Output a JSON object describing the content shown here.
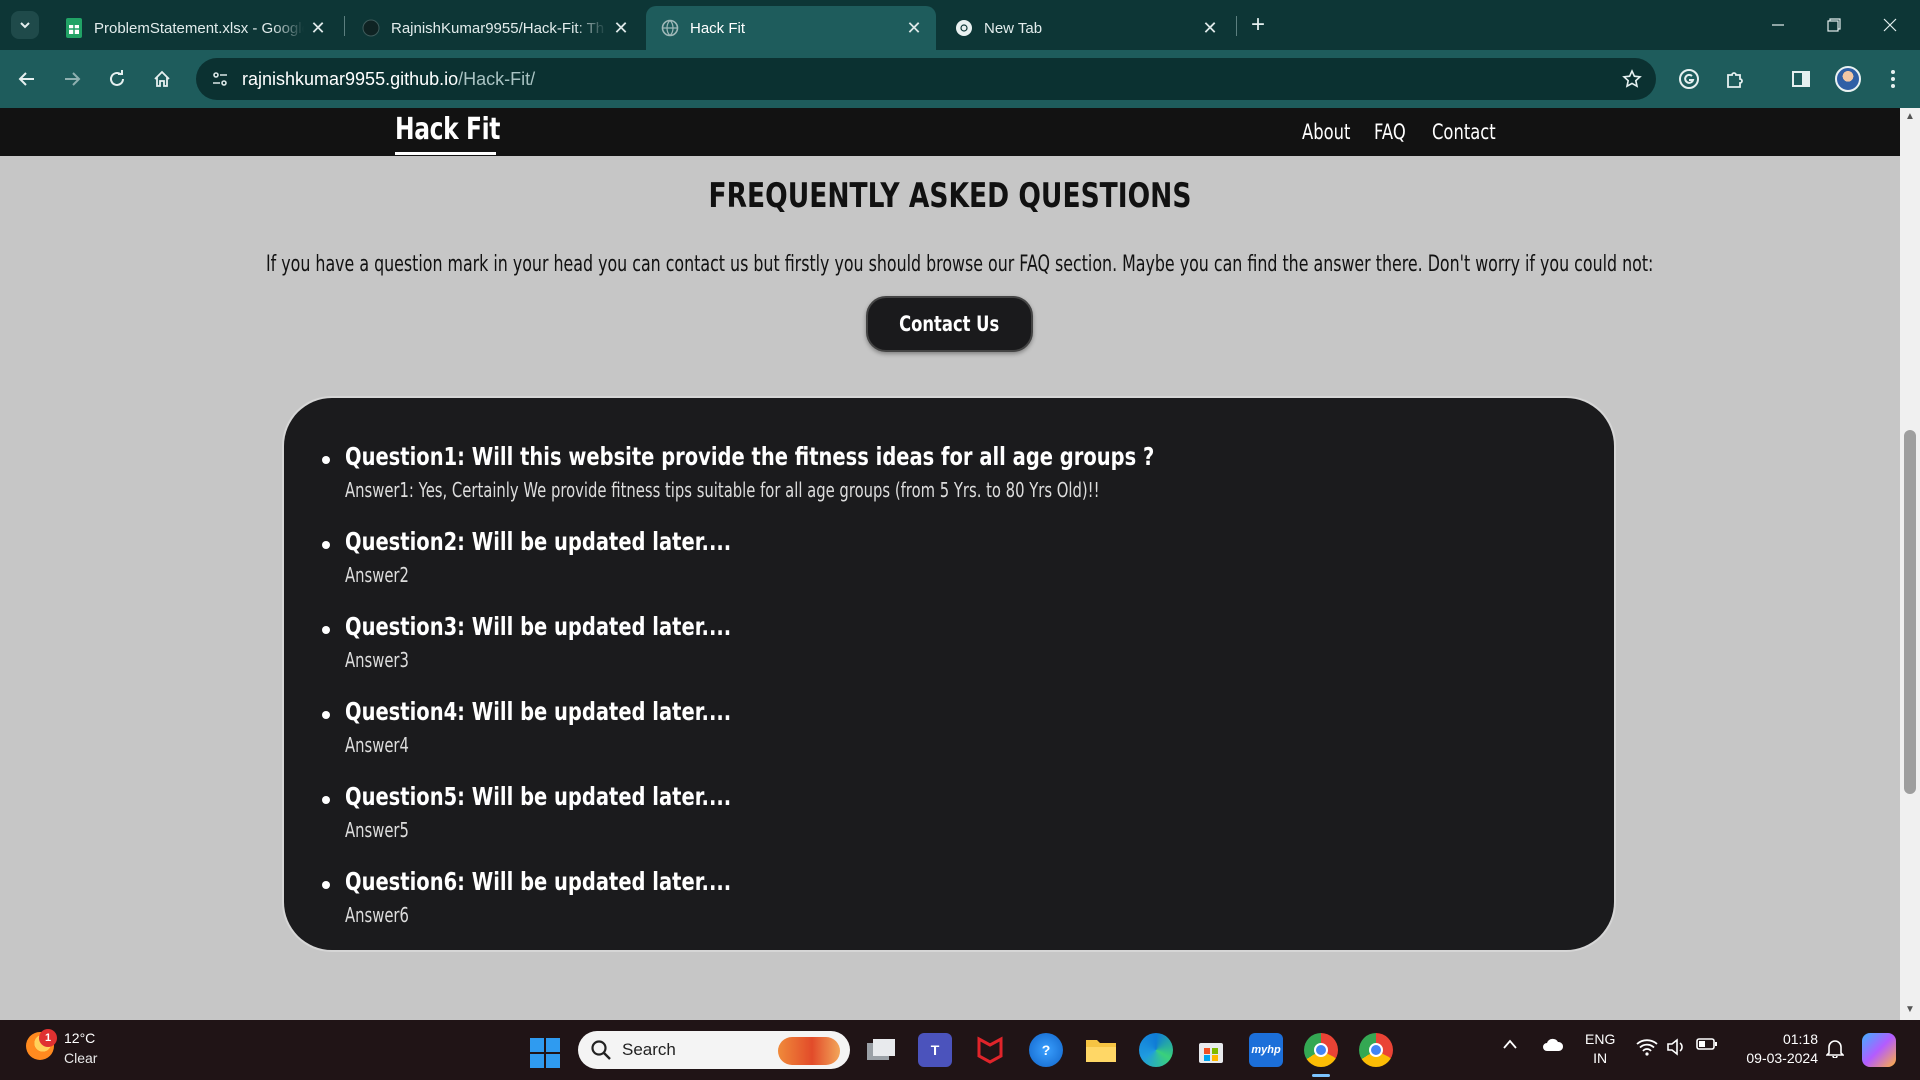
{
  "browser": {
    "tabs": [
      {
        "title": "ProblemStatement.xlsx - Google",
        "icon": "sheets-icon"
      },
      {
        "title": "RajnishKumar9955/Hack-Fit: Th",
        "icon": "github-icon"
      },
      {
        "title": "Hack Fit",
        "icon": "globe-icon"
      },
      {
        "title": "New Tab",
        "icon": "chrome-icon"
      }
    ],
    "active_tab": 2,
    "url_host": "rajnishkumar9955.github.io",
    "url_path": "/Hack-Fit/"
  },
  "site": {
    "brand": "Hack Fit",
    "nav": [
      "About",
      "FAQ",
      "Contact"
    ]
  },
  "faq": {
    "title": "FREQUENTLY ASKED QUESTIONS",
    "intro": "If you have a question mark in your head you can contact us but firstly you should browse our FAQ section. Maybe you can find the answer there. Don't worry if you could not:",
    "contact_button": "Contact Us",
    "items": [
      {
        "question": "Question1: Will this website provide the fitness ideas for all age groups ?",
        "answer": "Answer1: Yes, Certainly We provide fitness tips suitable for all age groups (from 5 Yrs. to 80 Yrs Old)!!"
      },
      {
        "question": "Question2: Will be updated later....",
        "answer": "Answer2"
      },
      {
        "question": "Question3: Will be updated later....",
        "answer": "Answer3"
      },
      {
        "question": "Question4: Will be updated later....",
        "answer": "Answer4"
      },
      {
        "question": "Question5: Will be updated later....",
        "answer": "Answer5"
      },
      {
        "question": "Question6: Will be updated later....",
        "answer": "Answer6"
      }
    ]
  },
  "taskbar": {
    "weather": {
      "temp": "12°C",
      "condition": "Clear",
      "badge": "1"
    },
    "search_label": "Search",
    "language": {
      "line1": "ENG",
      "line2": "IN"
    },
    "time": "01:18",
    "date": "09-03-2024"
  },
  "colors": {
    "chrome_dark": "#0d3636",
    "chrome_toolbar": "#1e5c5c",
    "page_bg": "#c6c6c6",
    "card_bg": "#1b1b1d",
    "taskbar_bg": "#201416"
  }
}
